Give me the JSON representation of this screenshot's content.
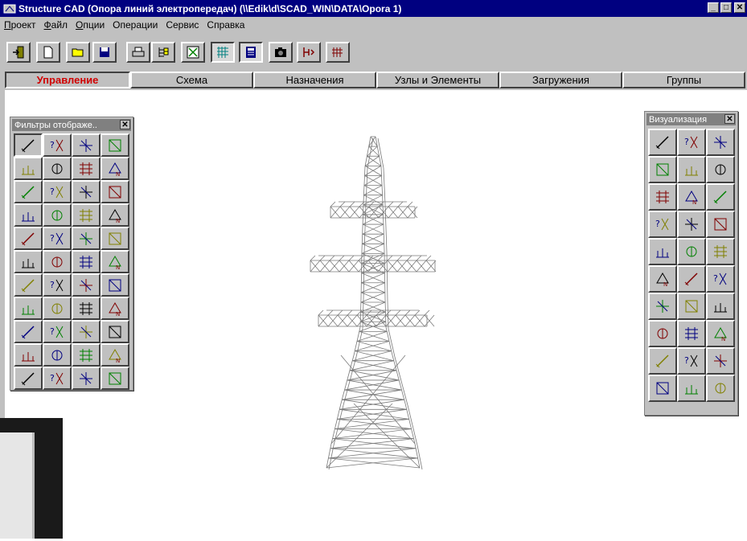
{
  "window": {
    "title": "Structure CAD (Опора линий электропередач) (\\\\Edik\\d\\SCAD_WIN\\DATA\\Opora 1)",
    "controls": [
      "_",
      "□",
      "✕"
    ]
  },
  "menu": [
    {
      "first": "П",
      "rest": "роект"
    },
    {
      "first": "Ф",
      "rest": "айл"
    },
    {
      "first": "О",
      "rest": "пции"
    },
    {
      "first": "",
      "rest": "Операции"
    },
    {
      "first": "",
      "rest": "Сервис"
    },
    {
      "first": "",
      "rest": "Справка"
    }
  ],
  "toolbar_icons": [
    "exit-icon",
    "new-file-icon",
    "open-folder-icon",
    "save-icon",
    "print-icon",
    "tree-icon",
    "scheme-check-icon",
    "mesh-icon",
    "calculator-icon",
    "camera-icon",
    "export-icon",
    "import-icon"
  ],
  "tabs": [
    {
      "label": "Управление",
      "active": true
    },
    {
      "label": "Схема",
      "active": false
    },
    {
      "label": "Назначения",
      "active": false
    },
    {
      "label": "Узлы и Элементы",
      "active": false
    },
    {
      "label": "Загружения",
      "active": false
    },
    {
      "label": "Группы",
      "active": false
    }
  ],
  "filters_palette": {
    "title": "Фильтры отображе..",
    "close": "✕",
    "rows": 11,
    "cols": 4
  },
  "visualization_palette": {
    "title": "Визуализация",
    "close": "✕",
    "rows": 10,
    "cols": 3
  },
  "colors": {
    "title_bar": "#000080",
    "chrome": "#c0c0c0",
    "active_tab_text": "#d00000",
    "model_lines": "#7a7a7a"
  }
}
